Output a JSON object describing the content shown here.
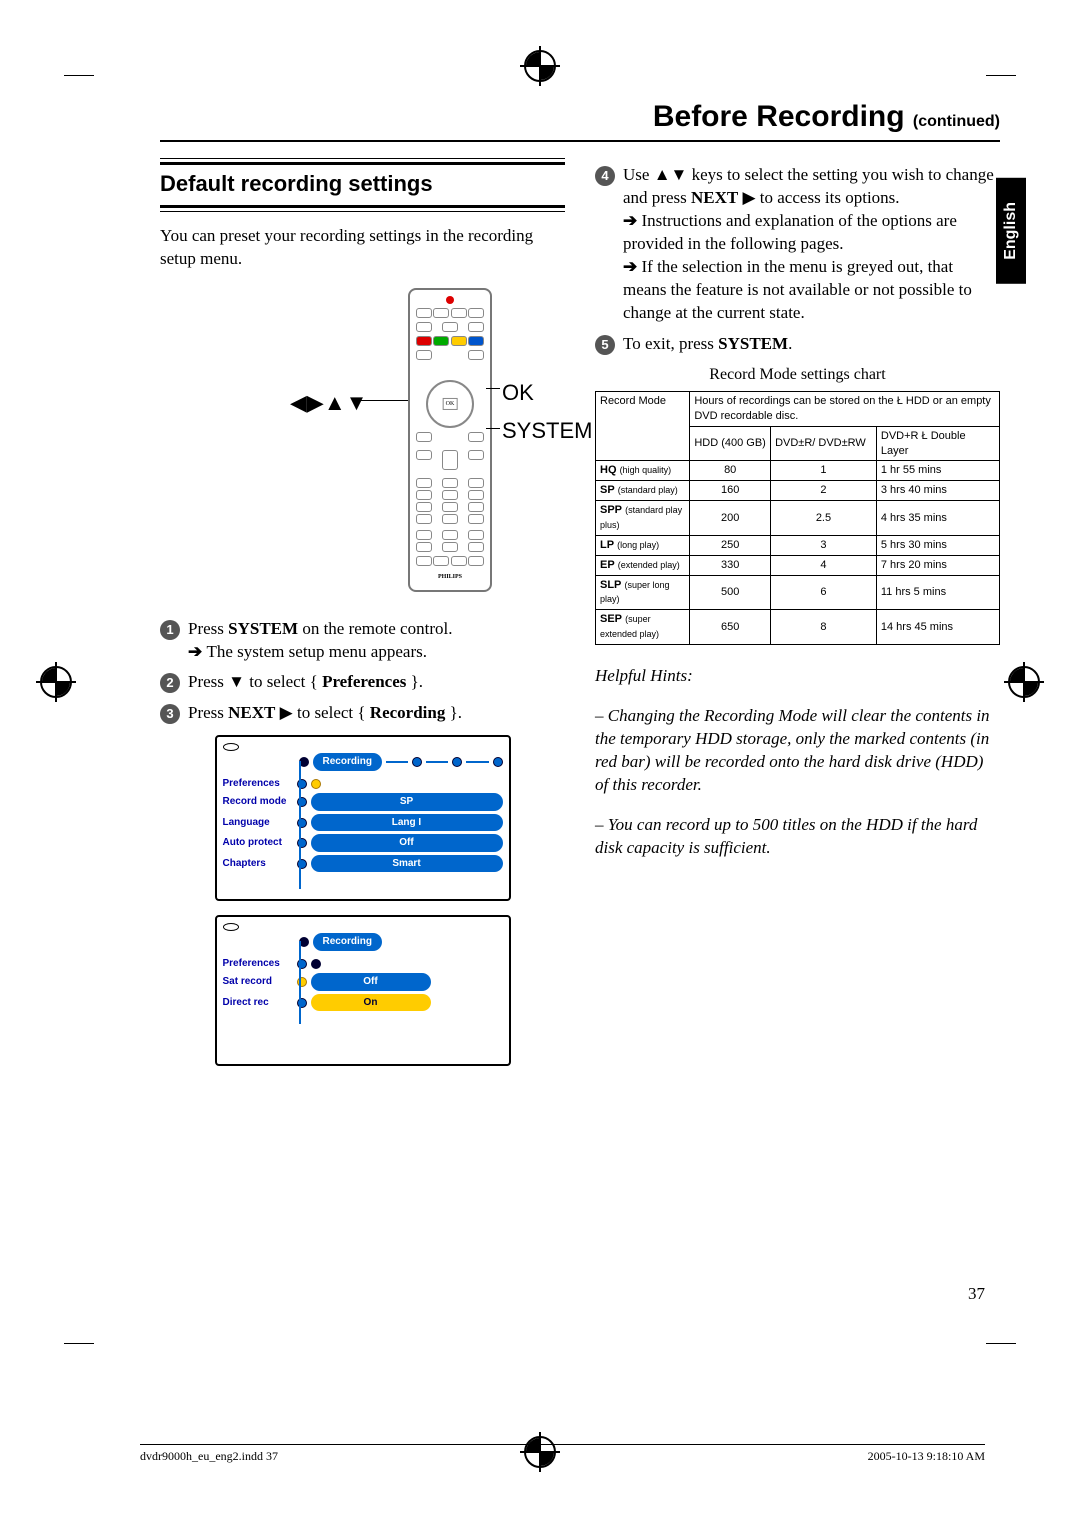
{
  "header": {
    "title_main": "Before Recording",
    "title_cont": "(continued)"
  },
  "lang_tab": "English",
  "section_heading": "Default recording settings",
  "intro": "You can preset your recording settings in the recording setup menu.",
  "remote_labels": {
    "arrows": "◀▶▲▼",
    "ok": "OK",
    "system": "SYSTEM"
  },
  "steps": {
    "s1_a": "Press ",
    "s1_b": "SYSTEM",
    "s1_c": " on the remote control.",
    "s1_sub": "The system setup menu appears.",
    "s2_a": "Press ▼ to select { ",
    "s2_b": "Preferences",
    "s2_c": " }.",
    "s3_a": "Press ",
    "s3_b": "NEXT",
    "s3_c": " ▶  to select { ",
    "s3_d": "Recording",
    "s3_e": " }.",
    "s4_a": "Use ▲▼ keys to select the setting you wish to change and press ",
    "s4_b": "NEXT",
    "s4_c": " ▶ to access its options.",
    "s4_sub1": "Instructions and explanation of the options are provided in the following pages.",
    "s4_sub2": "If the selection in the menu is greyed out, that means the feature is not available or not possible to change at the current state.",
    "s5_a": "To exit, press ",
    "s5_b": "SYSTEM",
    "s5_c": "."
  },
  "osd1": {
    "header": "Recording",
    "pref": "Preferences",
    "items": [
      {
        "label": "Record mode",
        "value": "SP"
      },
      {
        "label": "Language",
        "value": "Lang I"
      },
      {
        "label": "Auto protect",
        "value": "Off"
      },
      {
        "label": "Chapters",
        "value": "Smart"
      }
    ]
  },
  "osd2": {
    "header": "Recording",
    "pref": "Preferences",
    "items": [
      {
        "label": "Sat record",
        "value": "Off"
      },
      {
        "label": "Direct rec",
        "value": "On"
      }
    ]
  },
  "table_caption": "Record Mode settings chart",
  "chart_data": {
    "type": "table",
    "title": "Record Mode settings chart",
    "header_row1": "Record Mode",
    "header_row1b": "Hours of recordings can be stored on the Ł HDD or an empty DVD recordable disc.",
    "columns": [
      "HDD (400 GB)",
      "DVD±R/ DVD±RW",
      "DVD+R Ł Double Layer"
    ],
    "rows": [
      {
        "mode_b": "HQ",
        "mode_s": "(high quality)",
        "hdd": "80",
        "dvd": "1",
        "dl": "1 hr 55 mins"
      },
      {
        "mode_b": "SP",
        "mode_s": "(standard play)",
        "hdd": "160",
        "dvd": "2",
        "dl": "3 hrs 40 mins"
      },
      {
        "mode_b": "SPP",
        "mode_s": "(standard play plus)",
        "hdd": "200",
        "dvd": "2.5",
        "dl": "4 hrs 35 mins"
      },
      {
        "mode_b": "LP",
        "mode_s": "(long play)",
        "hdd": "250",
        "dvd": "3",
        "dl": "5 hrs 30 mins"
      },
      {
        "mode_b": "EP",
        "mode_s": "(extended play)",
        "hdd": "330",
        "dvd": "4",
        "dl": "7 hrs 20 mins"
      },
      {
        "mode_b": "SLP",
        "mode_s": "(super long play)",
        "hdd": "500",
        "dvd": "6",
        "dl": "11 hrs 5 mins"
      },
      {
        "mode_b": "SEP",
        "mode_s": "(super extended play)",
        "hdd": "650",
        "dvd": "8",
        "dl": "14 hrs 45 mins"
      }
    ]
  },
  "hints": {
    "title": "Helpful Hints:",
    "h1": "– Changing the Recording Mode will clear the contents in the temporary HDD storage, only the marked contents (in red bar) will be recorded onto the hard disk drive (HDD) of this recorder.",
    "h2": "– You can record up to 500 titles on the HDD if the hard disk capacity is sufficient."
  },
  "page_number": "37",
  "footer": {
    "left": "dvdr9000h_eu_eng2.indd   37",
    "right": "2005-10-13   9:18:10 AM"
  }
}
